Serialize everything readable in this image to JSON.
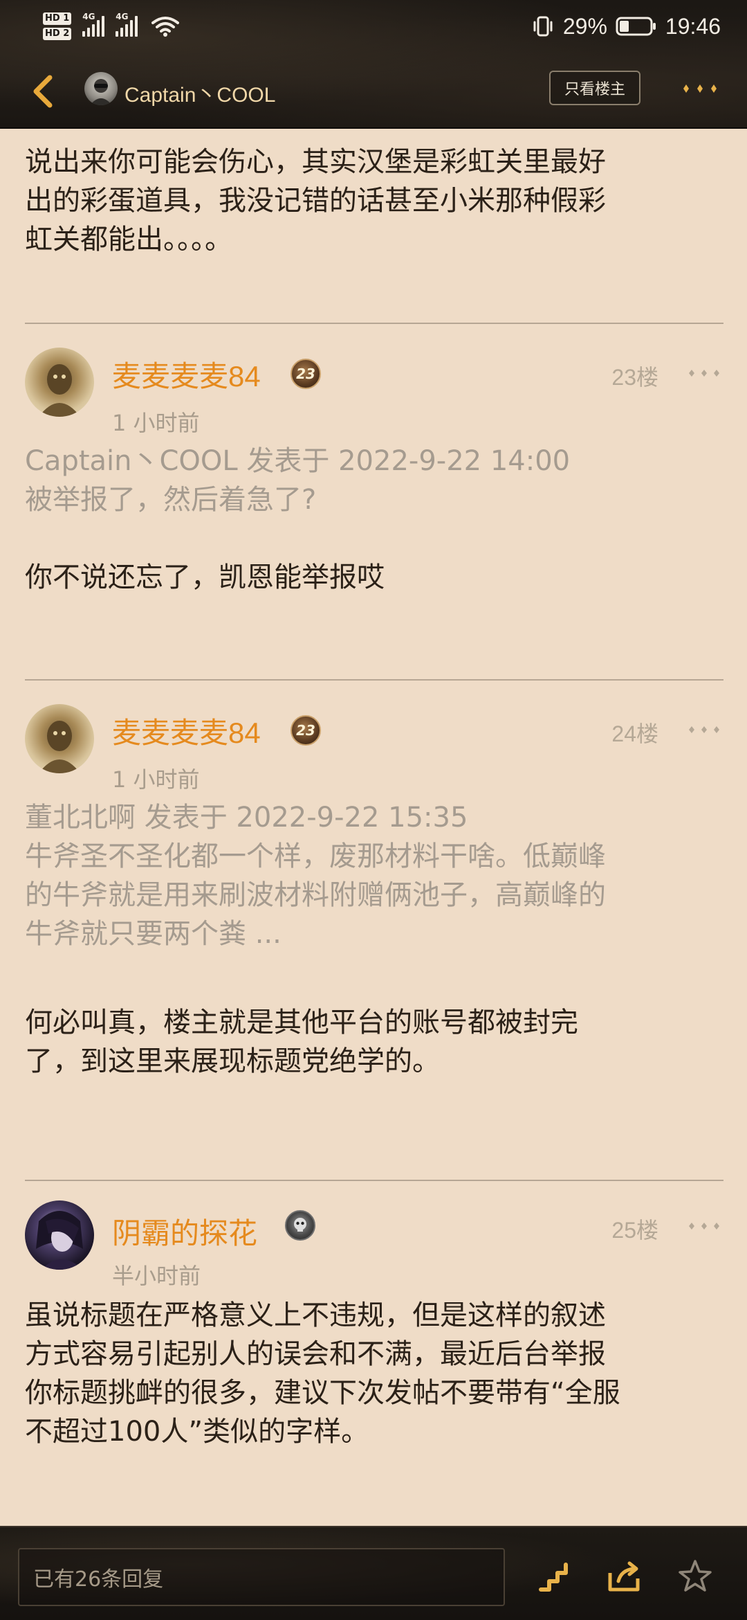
{
  "status_bar": {
    "hd1": "HD 1",
    "hd2": "HD 2",
    "net1": "4G",
    "net2": "4G",
    "battery_pct": "29%",
    "time": "19:46"
  },
  "nav": {
    "title": "Captain丶COOL",
    "op_only_label": "只看楼主",
    "icons": [
      "chevron-left-icon",
      "more-dots-icon"
    ]
  },
  "post": {
    "text_lines": [
      "说出来你可能会伤心，其实汉堡是彩虹关里最好",
      "出的彩蛋道具，我没记错的话甚至小米那种假彩",
      "虹关都能出。。。。"
    ]
  },
  "replies": [
    {
      "user": "麦麦麦麦84",
      "level": "23",
      "floor": "23楼",
      "time": "1 小时前",
      "quote_lines": [
        "Captain丶COOL 发表于 2022-9-22 14:00",
        "被举报了，然后着急了?"
      ],
      "body_lines": [
        "你不说还忘了，凯恩能举报哎"
      ]
    },
    {
      "user": "麦麦麦麦84",
      "level": "23",
      "floor": "24楼",
      "time": "1 小时前",
      "quote_lines": [
        "董北北啊 发表于 2022-9-22 15:35",
        "牛斧圣不圣化都一个样，废那材料干啥。低巅峰",
        "的牛斧就是用来刷波材料附赠俩池子，高巅峰的",
        "牛斧就只要两个粪 ..."
      ],
      "body_lines": [
        "何必叫真，楼主就是其他平台的账号都被封完",
        "了，到这里来展现标题党绝学的。"
      ]
    },
    {
      "user": "阴霸的探花",
      "level": "",
      "floor": "25楼",
      "time": "半小时前",
      "quote_lines": [],
      "body_lines": [
        "虽说标题在严格意义上不违规，但是这样的叙述",
        "方式容易引起别人的误会和不满，最近后台举报",
        "你标题挑衅的很多，建议下次发帖不要带有“全服",
        "不超过100人”类似的字样。"
      ]
    }
  ],
  "bottom_bar": {
    "reply_placeholder": "已有26条回复",
    "icons": [
      "stairs-icon",
      "share-icon",
      "star-icon"
    ]
  },
  "colors": {
    "background": "#efdcc7",
    "username": "#e58a1e",
    "quote": "#a59b8f",
    "header": "#1c1814"
  }
}
